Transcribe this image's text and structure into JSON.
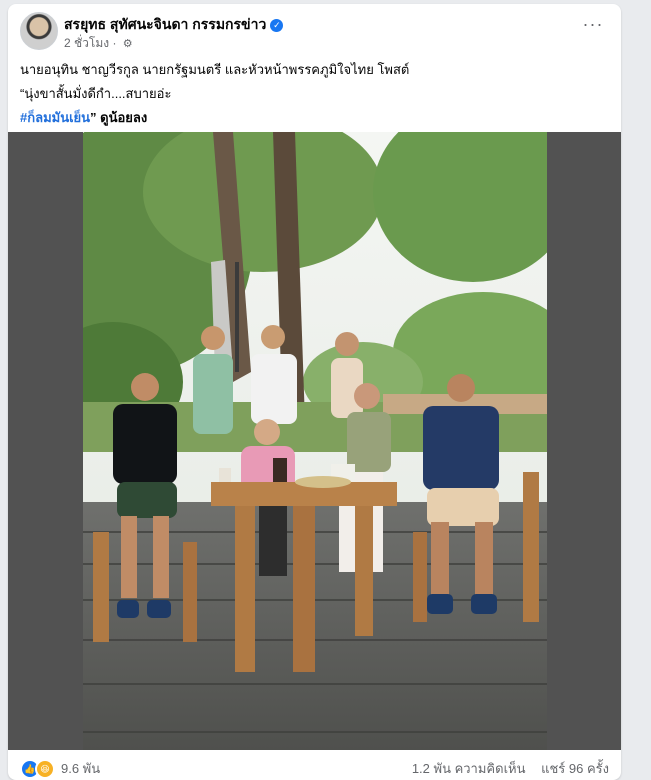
{
  "post": {
    "author": "สรยุทธ สุทัศนะจินดา กรรมกรข่าว",
    "time": "2 ชั่วโมง",
    "privacy_icon": "globe-icon",
    "more_icon": "more-options-icon",
    "caption_line1": "นายอนุทิน ชาญวีรกูล นายกรัฐมนตรี และหัวหน้าพรรคภูมิใจไทย โพสต์",
    "caption_line2": "“นุ่งขาสั้นมั่งดีกำ....สบายอ่ะ",
    "hashtag": "#ก็ลมมันเย็น",
    "caption_line3_suffix": "” ดูน้อยลง"
  },
  "footer": {
    "reaction_icons": [
      "like-icon",
      "haha-icon"
    ],
    "reaction_count": "9.6 พัน",
    "comments": "1.2 พัน ความคิดเห็น",
    "shares": "แชร์ 96 ครั้ง"
  },
  "colors": {
    "accent": "#1877f2",
    "hashtag": "#216fdb",
    "media_background": "#525252",
    "page_background": "#e9ebee"
  }
}
